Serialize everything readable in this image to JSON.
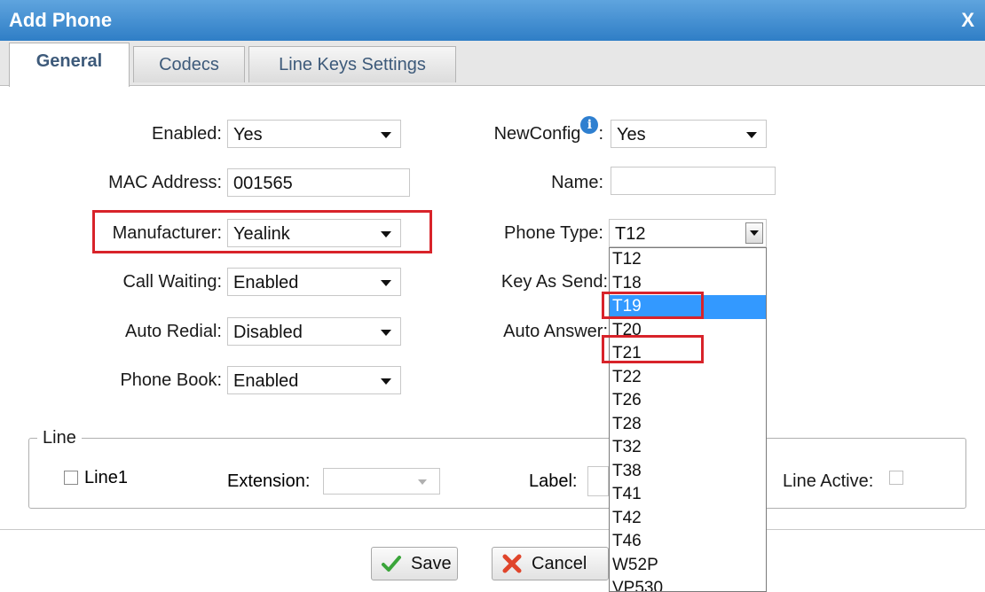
{
  "dialog": {
    "title": "Add Phone",
    "close": "X"
  },
  "tabs": [
    {
      "label": "General",
      "active": true
    },
    {
      "label": "Codecs",
      "active": false
    },
    {
      "label": "Line Keys Settings",
      "active": false
    }
  ],
  "left": {
    "enabled": {
      "label": "Enabled:",
      "value": "Yes"
    },
    "mac": {
      "label": "MAC Address:",
      "value": "001565"
    },
    "manufacturer": {
      "label": "Manufacturer:",
      "value": "Yealink"
    },
    "call_waiting": {
      "label": "Call Waiting:",
      "value": "Enabled"
    },
    "auto_redial": {
      "label": "Auto Redial:",
      "value": "Disabled"
    },
    "phone_book": {
      "label": "Phone Book:",
      "value": "Enabled"
    }
  },
  "right": {
    "newconfig": {
      "label": "NewConfig",
      "colon": ":",
      "value": "Yes",
      "info": "i"
    },
    "name": {
      "label": "Name:",
      "value": ""
    },
    "phone_type": {
      "label": "Phone Type:",
      "value": "T12"
    },
    "key_as_send": {
      "label": "Key As Send:"
    },
    "auto_answer": {
      "label": "Auto Answer:"
    }
  },
  "phone_type_options": [
    "T12",
    "T18",
    "T19",
    "T20",
    "T21",
    "T22",
    "T26",
    "T28",
    "T32",
    "T38",
    "T41",
    "T42",
    "T46",
    "W52P",
    "VP530"
  ],
  "highlighted_option": "T19",
  "line": {
    "legend": "Line",
    "line1": "Line1",
    "extension_label": "Extension:",
    "label_label": "Label:",
    "line_active": "Line Active:"
  },
  "buttons": {
    "save": "Save",
    "cancel": "Cancel"
  },
  "colors": {
    "title_bar": "#3a87cd",
    "highlight": "#3399ff",
    "annotation_red": "#d8232a"
  }
}
